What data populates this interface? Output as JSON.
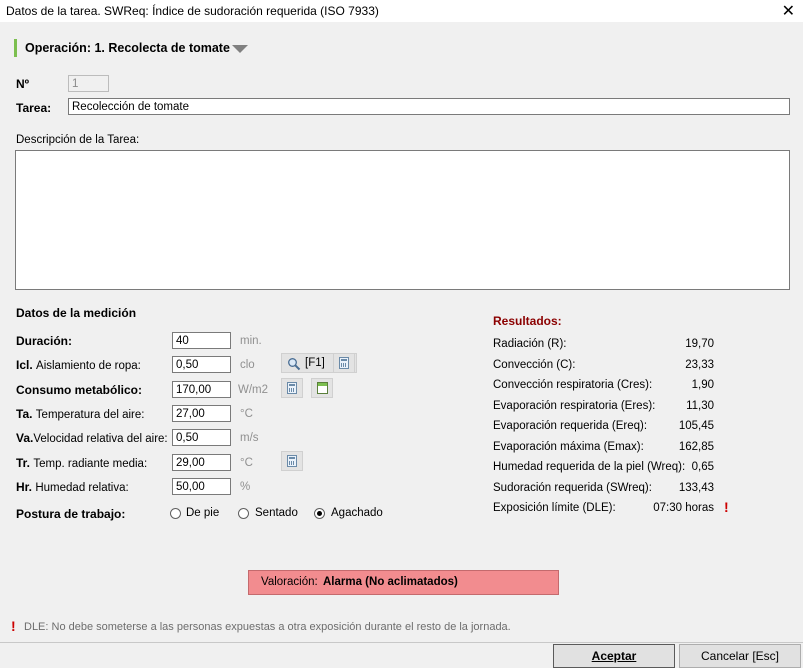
{
  "window": {
    "title": "Datos de la tarea. SWReq: Índice de sudoración requerida (ISO 7933)",
    "close_glyph": "✕"
  },
  "operation": {
    "label": "Operación: 1. Recolecta de tomate"
  },
  "fields": {
    "numero": {
      "label": "Nº",
      "value": "1"
    },
    "tarea": {
      "label": "Tarea:",
      "value": "Recolección de tomate"
    },
    "descripcion": {
      "label": "Descripción de la Tarea:",
      "value": ""
    }
  },
  "medicion": {
    "section_title": "Datos de la medición",
    "duracion": {
      "label": "Duración:",
      "value": "40",
      "unit": "min."
    },
    "icl": {
      "code": "Icl.",
      "label": "Aislamiento de ropa:",
      "value": "0,50",
      "unit": "clo",
      "search_label": "[F1]"
    },
    "consumo": {
      "label": "Consumo metabólico:",
      "value": "170,00",
      "unit": "W/m2"
    },
    "ta": {
      "code": "Ta.",
      "label": "Temperatura del aire:",
      "value": "27,00",
      "unit": "°C"
    },
    "va": {
      "code": "Va.",
      "label": "Velocidad relativa del aire:",
      "value": "0,50",
      "unit": "m/s"
    },
    "tr": {
      "code": "Tr.",
      "label": "Temp. radiante media:",
      "value": "29,00",
      "unit": "°C"
    },
    "hr": {
      "code": "Hr.",
      "label": "Humedad relativa:",
      "value": "50,00",
      "unit": "%"
    }
  },
  "postura": {
    "label": "Postura de trabajo:",
    "options": [
      "De pie",
      "Sentado",
      "Agachado"
    ],
    "selected": "Agachado"
  },
  "resultados": {
    "title": "Resultados:",
    "title_color": "#8b0000",
    "rows": [
      {
        "label": "Radiación (R):",
        "value": "19,70"
      },
      {
        "label": "Convección (C):",
        "value": "23,33"
      },
      {
        "label": "Convección respiratoria (Cres):",
        "value": "1,90"
      },
      {
        "label": "Evaporación respiratoria (Eres):",
        "value": "11,30"
      },
      {
        "label": "Evaporación requerida (Ereq):",
        "value": "105,45"
      },
      {
        "label": "Evaporación máxima (Emax):",
        "value": "162,85"
      },
      {
        "label": "Humedad requerida de la piel (Wreq):",
        "value": "0,65"
      },
      {
        "label": "Sudoración requerida (SWreq):",
        "value": "133,43"
      },
      {
        "label": "Exposición límite (DLE):",
        "value": "07:30 horas"
      }
    ],
    "alert_glyph": "!"
  },
  "valoracion": {
    "label": "Valoración:",
    "value": "Alarma (No aclimatados)",
    "color": "#f28c8f"
  },
  "footer": {
    "note": "DLE: No debe someterse a las personas expuestas a otra exposición durante el resto de la jornada.",
    "accept_label": "Aceptar",
    "cancel_label": "Cancelar [Esc]"
  },
  "icons": {
    "close": "close-icon",
    "dropdown": "triangle-down-icon",
    "calculator": "calculator-icon",
    "table": "table-icon",
    "search": "magnifier-icon",
    "alert": "exclamation-icon"
  }
}
